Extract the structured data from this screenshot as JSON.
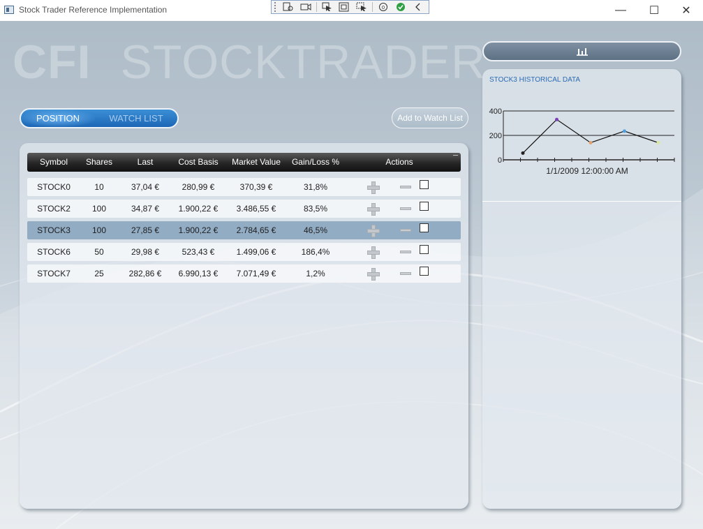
{
  "window": {
    "title": "Stock Trader Reference Implementation",
    "minimize_glyph": "—",
    "maximize_glyph": "☐",
    "close_glyph": "✕"
  },
  "brand": {
    "bold": "CFI",
    "light": "STOCKTRADER"
  },
  "tabs": [
    {
      "label": "POSITION",
      "selected": true
    },
    {
      "label": "WATCH LIST",
      "selected": false
    }
  ],
  "add_to_watch_list_label": "Add to Watch List",
  "positions": {
    "columns": [
      "Symbol",
      "Shares",
      "Last",
      "Cost Basis",
      "Market Value",
      "Gain/Loss %",
      "Actions"
    ],
    "rows": [
      {
        "symbol": "STOCK0",
        "shares": "10",
        "last": "37,04 €",
        "cost": "280,99 €",
        "market": "370,39 €",
        "gain": "31,8%",
        "selected": false
      },
      {
        "symbol": "STOCK2",
        "shares": "100",
        "last": "34,87 €",
        "cost": "1.900,22 €",
        "market": "3.486,55 €",
        "gain": "83,5%",
        "selected": false
      },
      {
        "symbol": "STOCK3",
        "shares": "100",
        "last": "27,85 €",
        "cost": "1.900,22 €",
        "market": "2.784,65 €",
        "gain": "46,5%",
        "selected": true
      },
      {
        "symbol": "STOCK6",
        "shares": "50",
        "last": "29,98 €",
        "cost": "523,43 €",
        "market": "1.499,06 €",
        "gain": "186,4%",
        "selected": false
      },
      {
        "symbol": "STOCK7",
        "shares": "25",
        "last": "282,86 €",
        "cost": "6.990,13 €",
        "market": "7.071,49 €",
        "gain": "1,2%",
        "selected": false
      }
    ]
  },
  "chart_panel": {
    "title": "STOCK3 HISTORICAL DATA",
    "toggle_icon": "bar-chart-icon"
  },
  "chart_data": {
    "type": "line",
    "title": "STOCK3 HISTORICAL DATA",
    "xlabel": "1/1/2009 12:00:00 AM",
    "ylabel": "",
    "ylim": [
      0,
      400
    ],
    "yticks": [
      0,
      200,
      400
    ],
    "grid": true,
    "series": [
      {
        "points": [
          {
            "x": 0,
            "y": 55,
            "color": "#222222"
          },
          {
            "x": 1,
            "y": 330,
            "color": "#7b3fb8"
          },
          {
            "x": 2,
            "y": 140,
            "color": "#e0a070"
          },
          {
            "x": 3,
            "y": 235,
            "color": "#4fa0e0"
          },
          {
            "x": 4,
            "y": 140,
            "color": "#d8e8a0"
          }
        ]
      }
    ]
  }
}
